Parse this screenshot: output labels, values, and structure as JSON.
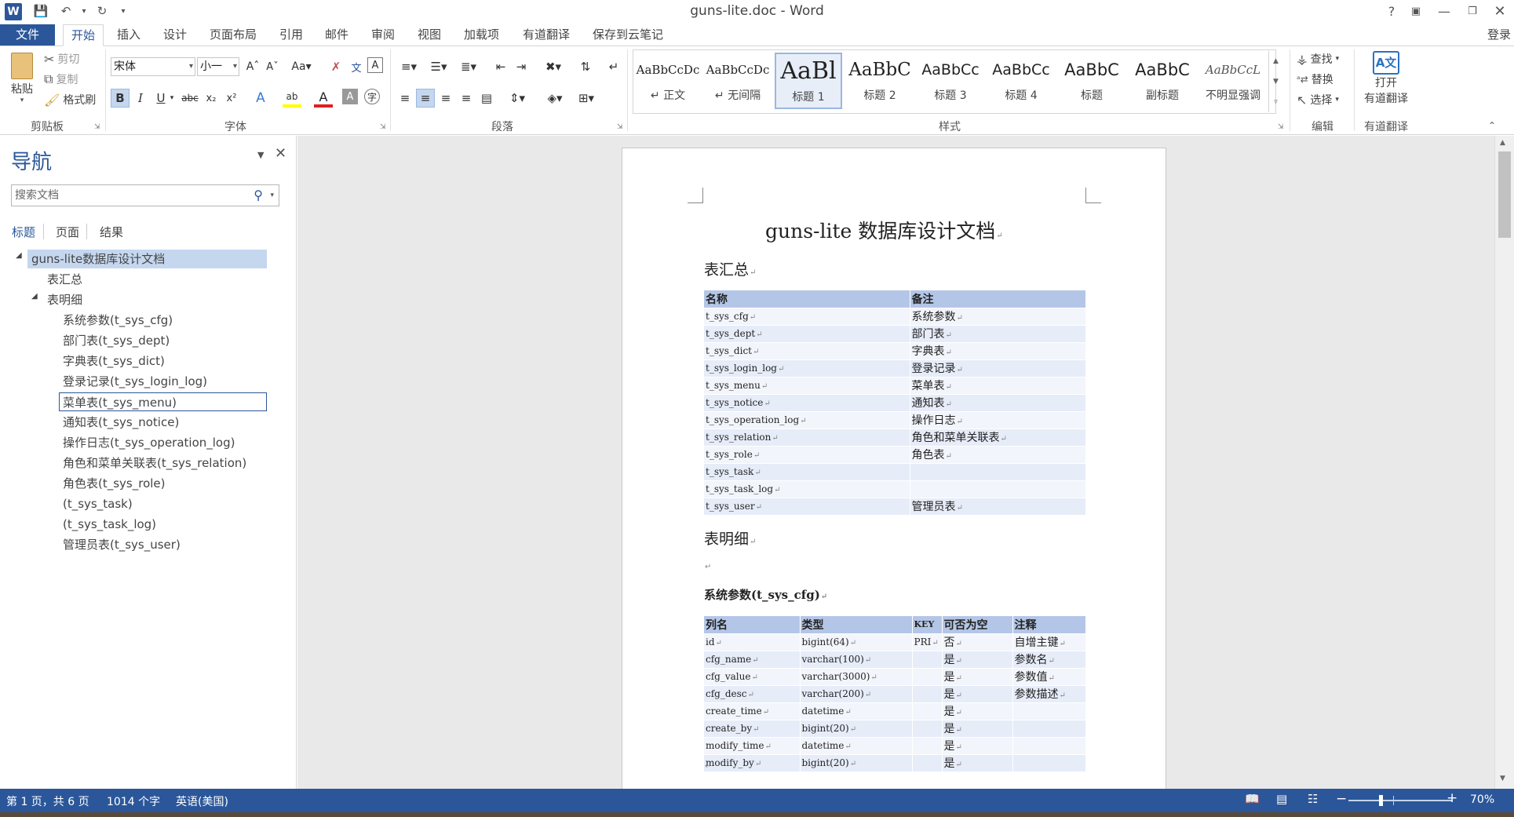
{
  "window": {
    "title": "guns-lite.doc - Word",
    "help": "?",
    "login": "登录"
  },
  "tabs": [
    "文件",
    "开始",
    "插入",
    "设计",
    "页面布局",
    "引用",
    "邮件",
    "审阅",
    "视图",
    "加载项",
    "有道翻译",
    "保存到云笔记"
  ],
  "ribbon": {
    "clipboard": {
      "paste": "粘贴",
      "cut": "剪切",
      "copy": "复制",
      "format_painter": "格式刷",
      "label": "剪贴板"
    },
    "font": {
      "name": "宋体",
      "size": "小一",
      "label": "字体"
    },
    "paragraph": {
      "label": "段落"
    },
    "styles": {
      "label": "样式",
      "items": [
        {
          "sample": "AaBbCcDc",
          "name": "↵ 正文"
        },
        {
          "sample": "AaBbCcDc",
          "name": "↵ 无间隔"
        },
        {
          "sample": "AaBl",
          "name": "标题 1"
        },
        {
          "sample": "AaBbC",
          "name": "标题 2"
        },
        {
          "sample": "AaBbCc",
          "name": "标题 3"
        },
        {
          "sample": "AaBbCc",
          "name": "标题 4"
        },
        {
          "sample": "AaBbC",
          "name": "标题"
        },
        {
          "sample": "AaBbC",
          "name": "副标题"
        },
        {
          "sample": "AaBbCcL",
          "name": "不明显强调"
        }
      ]
    },
    "editing": {
      "find": "查找",
      "replace": "替换",
      "select": "选择",
      "label": "编辑"
    },
    "youdao": {
      "open": "打开",
      "translate": "有道翻译",
      "label": "有道翻译"
    }
  },
  "nav": {
    "title": "导航",
    "search_placeholder": "搜索文档",
    "tabs": [
      "标题",
      "页面",
      "结果"
    ],
    "root": "guns-lite数据库设计文档",
    "summary": "表汇总",
    "detail": "表明细",
    "children": [
      "系统参数(t_sys_cfg)",
      "部门表(t_sys_dept)",
      "字典表(t_sys_dict)",
      "登录记录(t_sys_login_log)",
      "菜单表(t_sys_menu)",
      "通知表(t_sys_notice)",
      "操作日志(t_sys_operation_log)",
      "角色和菜单关联表(t_sys_relation)",
      "角色表(t_sys_role)",
      "(t_sys_task)",
      "(t_sys_task_log)",
      "管理员表(t_sys_user)"
    ]
  },
  "document": {
    "title": "guns-lite 数据库设计文档",
    "summary_heading": "表汇总",
    "summary_headers": [
      "名称",
      "备注"
    ],
    "summary_rows": [
      [
        "t_sys_cfg",
        "系统参数"
      ],
      [
        "t_sys_dept",
        "部门表"
      ],
      [
        "t_sys_dict",
        "字典表"
      ],
      [
        "t_sys_login_log",
        "登录记录"
      ],
      [
        "t_sys_menu",
        "菜单表"
      ],
      [
        "t_sys_notice",
        "通知表"
      ],
      [
        "t_sys_operation_log",
        "操作日志"
      ],
      [
        "t_sys_relation",
        "角色和菜单关联表"
      ],
      [
        "t_sys_role",
        "角色表"
      ],
      [
        "t_sys_task",
        ""
      ],
      [
        "t_sys_task_log",
        ""
      ],
      [
        "t_sys_user",
        "管理员表"
      ]
    ],
    "detail_heading": "表明细",
    "cfg_heading": "系统参数(t_sys_cfg)",
    "cfg_headers": [
      "列名",
      "类型",
      "KEY",
      "可否为空",
      "注释"
    ],
    "cfg_rows": [
      [
        "id",
        "bigint(64)",
        "PRI",
        "否",
        "自增主键"
      ],
      [
        "cfg_name",
        "varchar(100)",
        "",
        "是",
        "参数名"
      ],
      [
        "cfg_value",
        "varchar(3000)",
        "",
        "是",
        "参数值"
      ],
      [
        "cfg_desc",
        "varchar(200)",
        "",
        "是",
        "参数描述"
      ],
      [
        "create_time",
        "datetime",
        "",
        "是",
        ""
      ],
      [
        "create_by",
        "bigint(20)",
        "",
        "是",
        ""
      ],
      [
        "modify_time",
        "datetime",
        "",
        "是",
        ""
      ],
      [
        "modify_by",
        "bigint(20)",
        "",
        "是",
        ""
      ]
    ]
  },
  "status": {
    "page": "第 1 页，共 6 页",
    "words": "1014 个字",
    "language": "英语(美国)",
    "zoom": "70%"
  },
  "colors": {
    "accent": "#2b579a",
    "table_header": "#b4c6e7"
  }
}
